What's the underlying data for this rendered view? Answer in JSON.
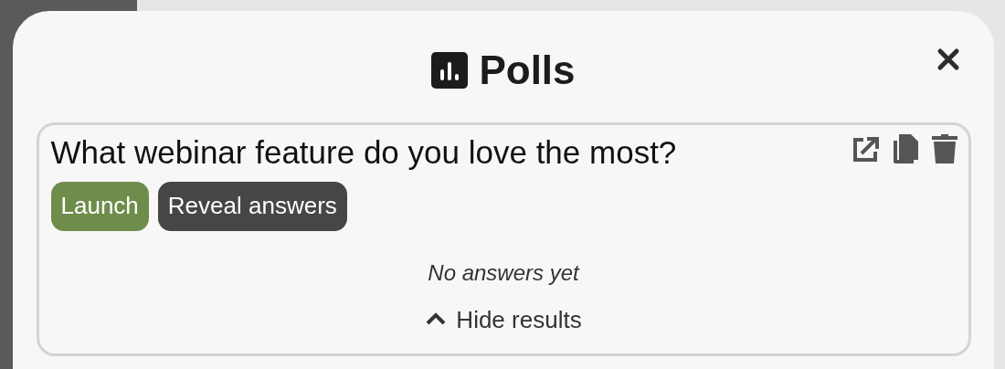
{
  "dialog": {
    "title": "Polls"
  },
  "poll": {
    "question": "What webinar feature do you love the most?",
    "buttons": [
      {
        "label": "Launch",
        "kind": "primary"
      },
      {
        "label": "Reveal answers",
        "kind": "secondary"
      }
    ],
    "empty_message": "No answers yet",
    "results_toggle": {
      "label": "Hide results",
      "expanded": true
    }
  }
}
